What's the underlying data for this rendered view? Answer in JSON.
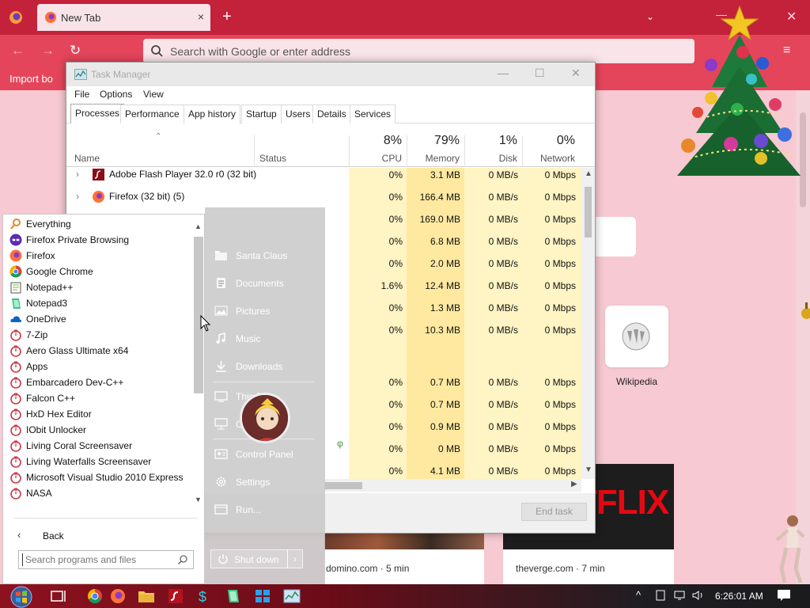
{
  "firefox": {
    "tab_title": "New Tab",
    "tab_close_icon": "×",
    "new_tab_icon": "+",
    "tab_list_icon": "⌄",
    "url_placeholder": "Search with Google or enter address",
    "bookmark_label": "Import bo",
    "back_icon": "←",
    "forward_icon": "→",
    "reload_icon": "↻",
    "hamburger_icon": "≡",
    "win_min_icon": "—",
    "win_close_icon": "✕"
  },
  "newtab": {
    "wikipedia_label": "Wikipedia",
    "card1_source": "domino.com · 5 min",
    "card2_source": "theverge.com · 7 min",
    "card2_image_text": "TFLIX"
  },
  "taskmanager": {
    "title": "Task Manager",
    "min_icon": "—",
    "max_icon": "☐",
    "close_icon": "✕",
    "menu": [
      "File",
      "Options",
      "View"
    ],
    "tabs": [
      "Processes",
      "Performance",
      "App history",
      "Startup",
      "Users",
      "Details",
      "Services"
    ],
    "active_tab": "Processes",
    "headers": {
      "sort_caret": "⌃",
      "name": "Name",
      "status": "Status",
      "cpu_pct": "8%",
      "cpu": "CPU",
      "memory_pct": "79%",
      "memory": "Memory",
      "disk_pct": "1%",
      "disk": "Disk",
      "network_pct": "0%",
      "network": "Network"
    },
    "rows": [
      {
        "name": "Adobe Flash Player 32.0 r0 (32 bit)",
        "cpu": "0%",
        "memory": "3.1 MB",
        "disk": "0 MB/s",
        "network": "0 Mbps"
      },
      {
        "name": "Firefox (32 bit) (5)",
        "cpu": "0%",
        "memory": "166.4 MB",
        "disk": "0 MB/s",
        "network": "0 Mbps"
      },
      {
        "name": "",
        "cpu": "0%",
        "memory": "169.0 MB",
        "disk": "0 MB/s",
        "network": "0 Mbps"
      },
      {
        "name": "",
        "cpu": "0%",
        "memory": "6.8 MB",
        "disk": "0 MB/s",
        "network": "0 Mbps"
      },
      {
        "name": "",
        "cpu": "0%",
        "memory": "2.0 MB",
        "disk": "0 MB/s",
        "network": "0 Mbps"
      },
      {
        "name": "",
        "cpu": "1.6%",
        "memory": "12.4 MB",
        "disk": "0 MB/s",
        "network": "0 Mbps"
      },
      {
        "name": "",
        "cpu": "0%",
        "memory": "1.3 MB",
        "disk": "0 MB/s",
        "network": "0 Mbps"
      },
      {
        "name": "",
        "cpu": "0%",
        "memory": "10.3 MB",
        "disk": "0 MB/s",
        "network": "0 Mbps"
      },
      {
        "name": "",
        "cpu": "",
        "memory": "",
        "disk": "",
        "network": ""
      },
      {
        "name": "",
        "cpu": "0%",
        "memory": "0.7 MB",
        "disk": "0 MB/s",
        "network": "0 Mbps"
      },
      {
        "name": "",
        "cpu": "0%",
        "memory": "0.7 MB",
        "disk": "0 MB/s",
        "network": "0 Mbps"
      },
      {
        "name": "",
        "cpu": "0%",
        "memory": "0.9 MB",
        "disk": "0 MB/s",
        "network": "0 Mbps"
      },
      {
        "name": "",
        "cpu": "0%",
        "memory": "0 MB",
        "disk": "0 MB/s",
        "network": "0 Mbps"
      },
      {
        "name": "",
        "cpu": "0%",
        "memory": "4.1 MB",
        "disk": "0 MB/s",
        "network": "0 Mbps"
      }
    ],
    "expand_icon": "›",
    "status_icon": "φ",
    "end_task": "End task",
    "scroll_up_icon": "▲",
    "scroll_down_icon": "▼",
    "scroll_right_icon": "▶"
  },
  "startmenu": {
    "programs": [
      {
        "label": "Everything",
        "icon": "search-icon"
      },
      {
        "label": "Firefox Private Browsing",
        "icon": "private-mask-icon"
      },
      {
        "label": "Firefox",
        "icon": "firefox-icon"
      },
      {
        "label": "Google Chrome",
        "icon": "chrome-icon"
      },
      {
        "label": "Notepad++",
        "icon": "notepadpp-icon"
      },
      {
        "label": "Notepad3",
        "icon": "notepad3-icon"
      },
      {
        "label": "OneDrive",
        "icon": "onedrive-icon"
      },
      {
        "label": "7-Zip",
        "icon": "folder-program-icon"
      },
      {
        "label": "Aero Glass Ultimate x64",
        "icon": "folder-program-icon"
      },
      {
        "label": "Apps",
        "icon": "folder-program-icon"
      },
      {
        "label": "Embarcadero Dev-C++",
        "icon": "folder-program-icon"
      },
      {
        "label": "Falcon C++",
        "icon": "folder-program-icon"
      },
      {
        "label": "HxD Hex Editor",
        "icon": "folder-program-icon"
      },
      {
        "label": "IObit Unlocker",
        "icon": "folder-program-icon"
      },
      {
        "label": "Living Coral Screensaver",
        "icon": "folder-program-icon"
      },
      {
        "label": "Living Waterfalls Screensaver",
        "icon": "folder-program-icon"
      },
      {
        "label": "Microsoft Visual Studio 2010 Express",
        "icon": "folder-program-icon"
      },
      {
        "label": "NASA",
        "icon": "folder-program-icon"
      }
    ],
    "back_icon": "‹",
    "back_label": "Back",
    "search_placeholder": "Search programs and files",
    "links": [
      {
        "label": "Santa Claus",
        "icon": "user-folder-icon"
      },
      {
        "label": "Documents",
        "icon": "documents-icon"
      },
      {
        "label": "Pictures",
        "icon": "pictures-icon"
      },
      {
        "label": "Music",
        "icon": "music-icon"
      },
      {
        "label": "Downloads",
        "icon": "downloads-icon"
      },
      {
        "label": "This PC",
        "icon": "computer-icon"
      },
      {
        "label": "Connect To",
        "icon": "network-icon"
      },
      {
        "label": "Control Panel",
        "icon": "control-panel-icon"
      },
      {
        "label": "Settings",
        "icon": "gear-icon"
      },
      {
        "label": "Run...",
        "icon": "run-icon"
      }
    ],
    "shutdown_label": "Shut down",
    "shutdown_arrow": "›",
    "scroll_up_icon": "▲",
    "scroll_down_icon": "▼"
  },
  "taskbar": {
    "clock": "6:26:01 AM",
    "tray_up_icon": "^",
    "pinned": [
      "task-view-icon",
      "chrome-icon",
      "firefox-icon",
      "file-explorer-icon",
      "flash-icon",
      "dollar-app-icon",
      "notepad3-icon",
      "grid-app-icon",
      "task-manager-icon"
    ]
  },
  "colors": {
    "firefox_tabbar": "#c4213b",
    "firefox_navbar": "#e4455a",
    "newtab_bg": "#f7c9d3",
    "tm_heat_light": "#fff4c4",
    "tm_heat_med": "#ffe9a0"
  }
}
